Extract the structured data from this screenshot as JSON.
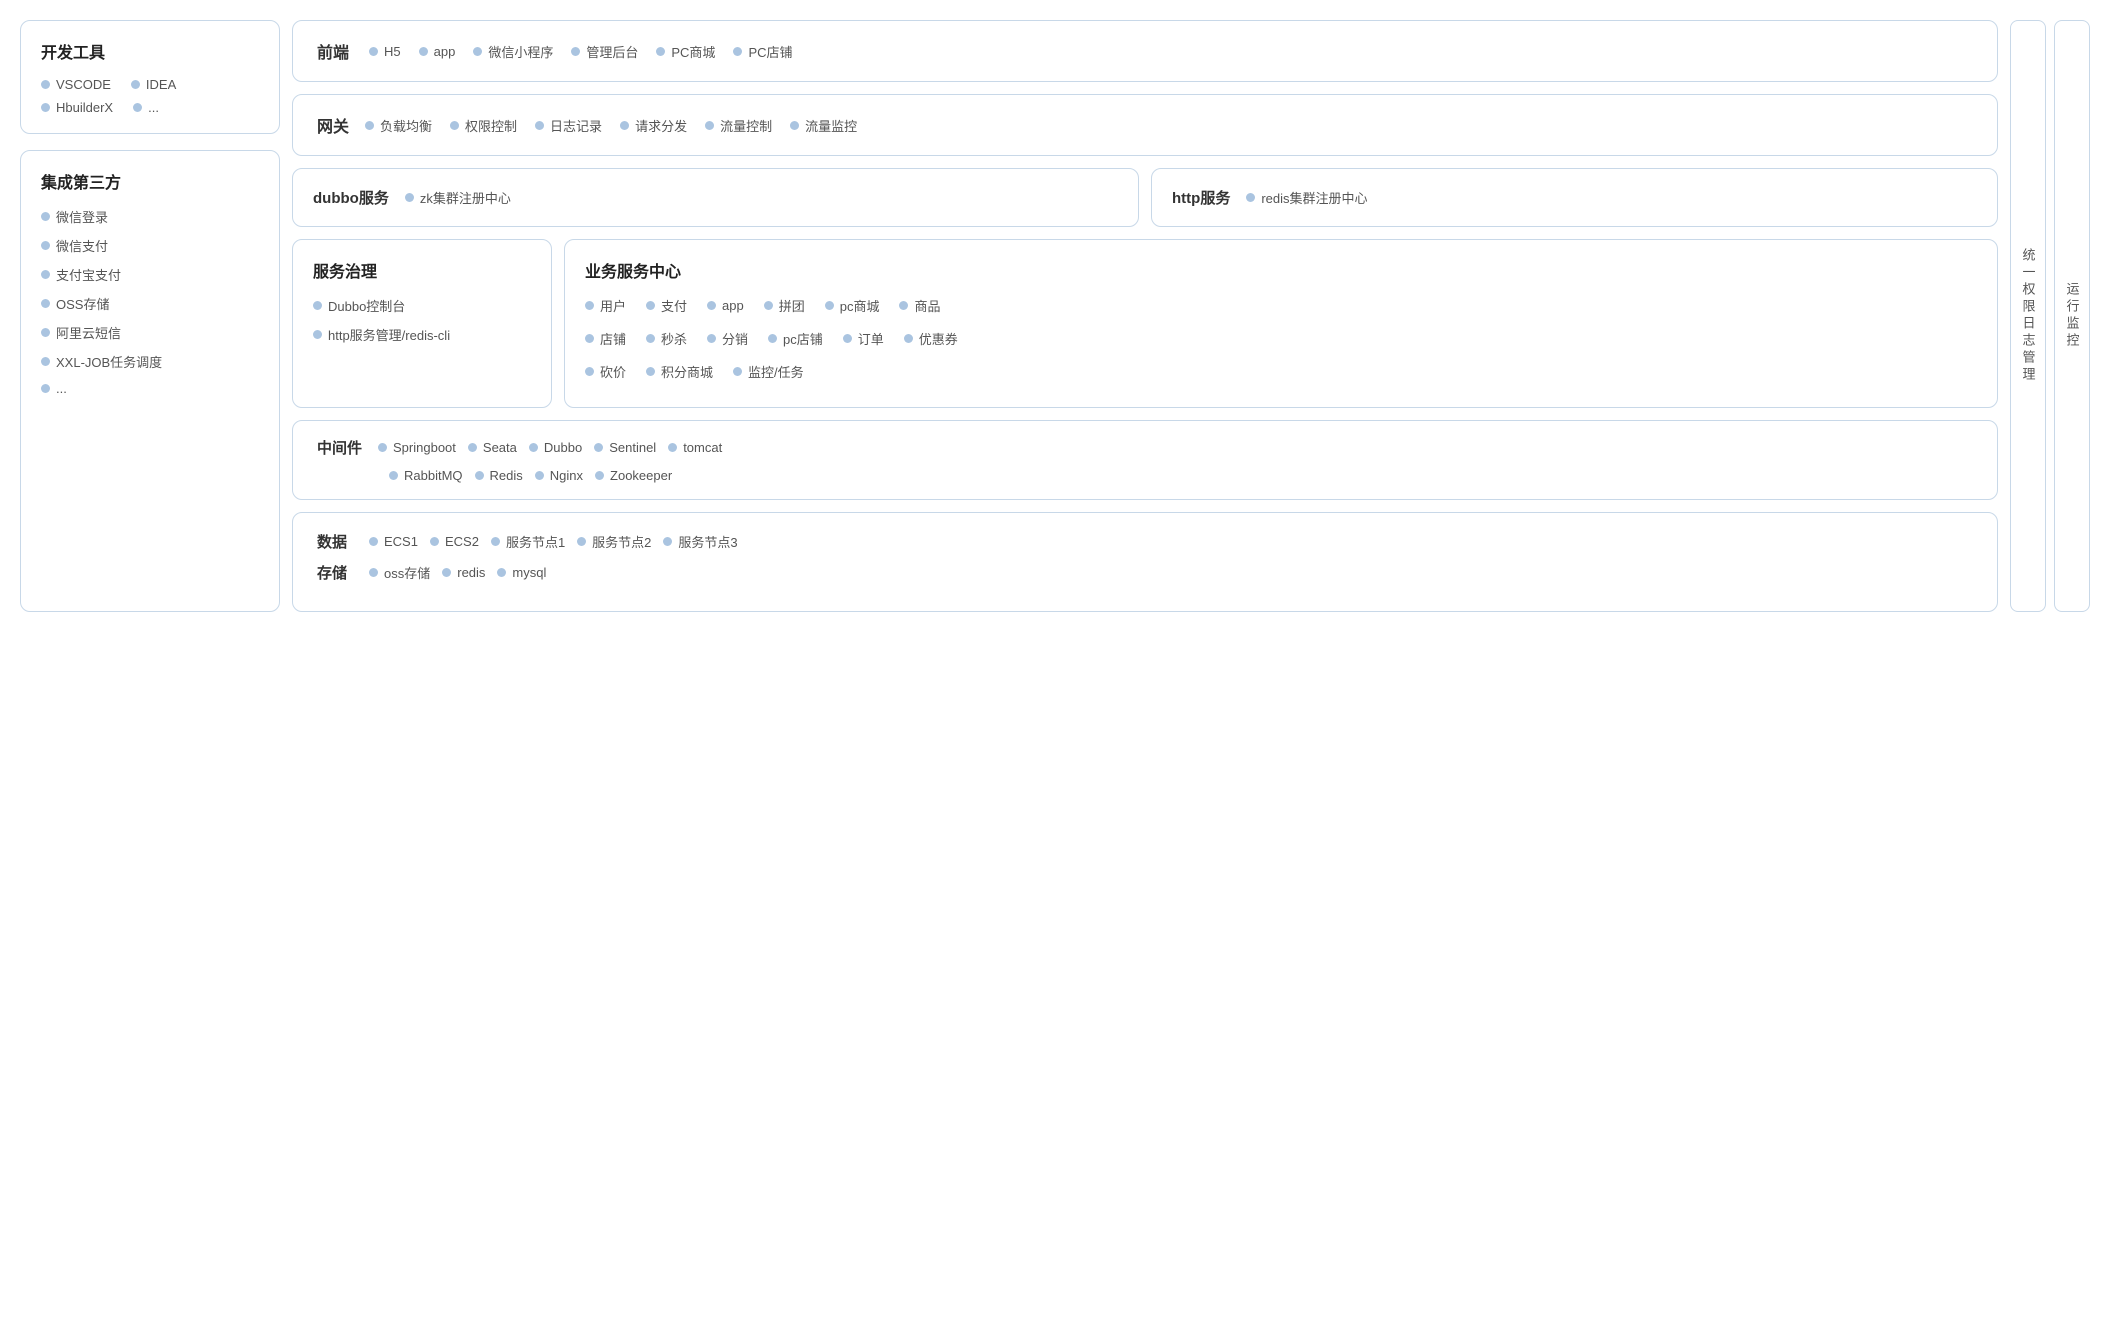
{
  "left": {
    "devtools": {
      "title": "开发工具",
      "items": [
        "VSCODE",
        "IDEA",
        "HbuilderX",
        "..."
      ]
    },
    "thirdparty": {
      "title": "集成第三方",
      "items": [
        "微信登录",
        "微信支付",
        "支付宝支付",
        "OSS存储",
        "阿里云短信",
        "XXL-JOB任务调度",
        "..."
      ]
    }
  },
  "center": {
    "frontend": {
      "label": "前端",
      "items": [
        "H5",
        "app",
        "微信小程序",
        "管理后台",
        "PC商城",
        "PC店铺"
      ]
    },
    "gateway": {
      "label": "网关",
      "items": [
        "负载均衡",
        "权限控制",
        "日志记录",
        "请求分发",
        "流量控制",
        "流量监控"
      ]
    },
    "dubbo": {
      "label": "dubbo服务",
      "item": "zk集群注册中心"
    },
    "http": {
      "label": "http服务",
      "item": "redis集群注册中心"
    },
    "governance": {
      "title": "服务治理",
      "items": [
        "Dubbo控制台",
        "http服务管理/redis-cli"
      ]
    },
    "business": {
      "title": "业务服务中心",
      "rows": [
        [
          "用户",
          "支付",
          "app",
          "拼团",
          "pc商城",
          "商品"
        ],
        [
          "店铺",
          "秒杀",
          "分销",
          "pc店铺",
          "订单",
          "优惠券"
        ],
        [
          "砍价",
          "积分商城",
          "监控/任务"
        ]
      ]
    },
    "middleware": {
      "label": "中间件",
      "row1": [
        "Springboot",
        "Seata",
        "Dubbo",
        "Sentinel",
        "tomcat"
      ],
      "row2": [
        "RabbitMQ",
        "Redis",
        "Nginx",
        "Zookeeper"
      ]
    },
    "datastorage": {
      "data_label": "数据",
      "data_items": [
        "ECS1",
        "ECS2",
        "服务节点1",
        "服务节点2",
        "服务节点3"
      ],
      "storage_label": "存储",
      "storage_items": [
        "oss存储",
        "redis",
        "mysql"
      ]
    }
  },
  "right": {
    "unified": "统一权限日志管理",
    "monitoring": "运行监控"
  }
}
